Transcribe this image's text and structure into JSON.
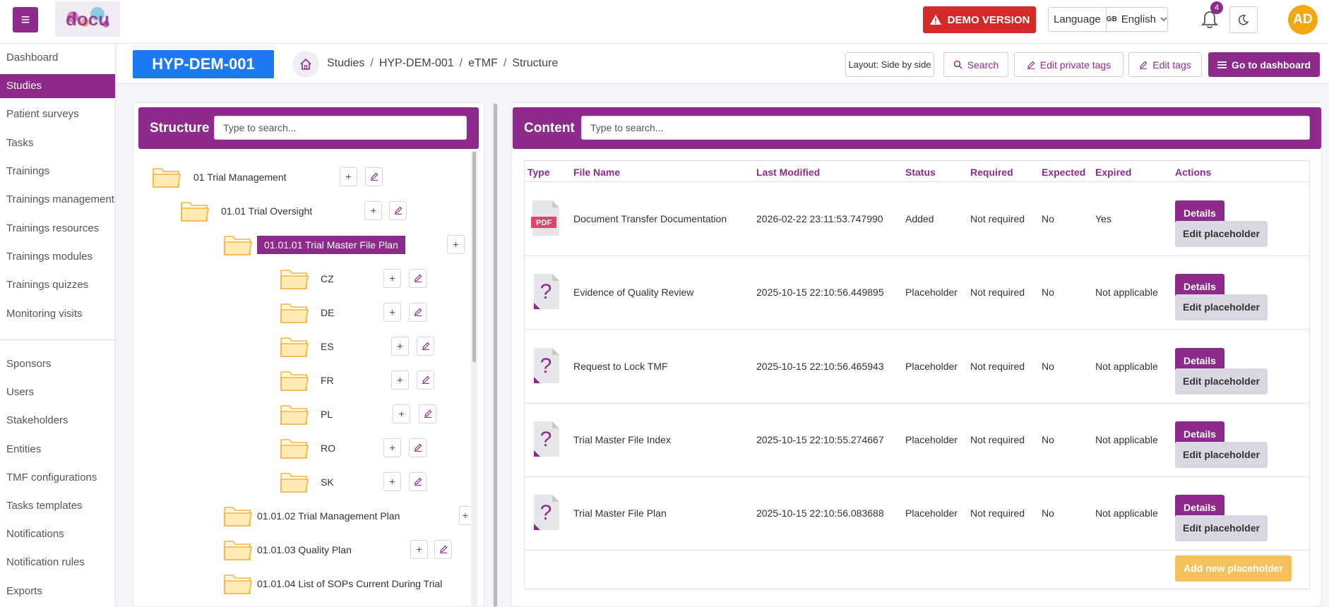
{
  "topbar": {
    "menu_icon": "hamburger-icon",
    "demo_label": "DEMO VERSION",
    "language_label": "Language",
    "language_flag": "GB",
    "language_value": "English",
    "notification_count": "4",
    "avatar_initials": "AD"
  },
  "sidebar": {
    "items": [
      "Dashboard",
      "Studies",
      "Patient surveys",
      "Tasks",
      "Trainings",
      "Trainings management",
      "Trainings resources",
      "Trainings modules",
      "Trainings quizzes",
      "Monitoring visits",
      "Sponsors",
      "Users",
      "Stakeholders",
      "Entities",
      "TMF configurations",
      "Tasks templates",
      "Notifications",
      "Notification rules",
      "Exports"
    ],
    "active": "Studies"
  },
  "header": {
    "study_id": "HYP-DEM-001",
    "breadcrumb": [
      "Studies",
      "HYP-DEM-001",
      "eTMF",
      "Structure"
    ],
    "layout_label": "Layout: Side by side",
    "search_label": "Search",
    "edit_private_tags_label": "Edit private tags",
    "edit_tags_label": "Edit tags",
    "go_to_dashboard_label": "Go to dashboard"
  },
  "structure": {
    "title": "Structure",
    "search_placeholder": "Type to search...",
    "tree": [
      {
        "label": "01 Trial Management",
        "level": 0
      },
      {
        "label": "01.01 Trial Oversight",
        "level": 1
      },
      {
        "label": "01.01.01 Trial Master File Plan",
        "level": 2,
        "selected": true
      },
      {
        "label": "CZ",
        "level": 3
      },
      {
        "label": "DE",
        "level": 3
      },
      {
        "label": "ES",
        "level": 3
      },
      {
        "label": "FR",
        "level": 3
      },
      {
        "label": "PL",
        "level": 3
      },
      {
        "label": "RO",
        "level": 3
      },
      {
        "label": "SK",
        "level": 3
      },
      {
        "label": "01.01.02 Trial Management Plan",
        "level": 2
      },
      {
        "label": "01.01.03 Quality Plan",
        "level": 2
      },
      {
        "label": "01.01.04 List of SOPs Current During Trial",
        "level": 2
      }
    ]
  },
  "content": {
    "title": "Content",
    "search_placeholder": "Type to search...",
    "columns": [
      "Type",
      "File Name",
      "Last Modified",
      "Status",
      "Required",
      "Expected",
      "Expired",
      "Actions"
    ],
    "rows": [
      {
        "type": "pdf",
        "name": "Document Transfer Documentation",
        "modified": "2026-02-22 23:11:53.747990",
        "status": "Added",
        "required": "Not required",
        "expected": "No",
        "expired": "Yes"
      },
      {
        "type": "placeholder",
        "name": "Evidence of Quality Review",
        "modified": "2025-10-15 22:10:56.449895",
        "status": "Placeholder",
        "required": "Not required",
        "expected": "No",
        "expired": "Not applicable"
      },
      {
        "type": "placeholder",
        "name": "Request to Lock TMF",
        "modified": "2025-10-15 22:10:56.465943",
        "status": "Placeholder",
        "required": "Not required",
        "expected": "No",
        "expired": "Not applicable"
      },
      {
        "type": "placeholder",
        "name": "Trial Master File Index",
        "modified": "2025-10-15 22:10:55.274667",
        "status": "Placeholder",
        "required": "Not required",
        "expected": "No",
        "expired": "Not applicable"
      },
      {
        "type": "placeholder",
        "name": "Trial Master File Plan",
        "modified": "2025-10-15 22:10:56.083688",
        "status": "Placeholder",
        "required": "Not required",
        "expected": "No",
        "expired": "Not applicable"
      }
    ],
    "details_label": "Details",
    "edit_placeholder_label": "Edit placeholder",
    "add_placeholder_label": "Add new placeholder",
    "pdf_label": "PDF"
  },
  "colors": {
    "primary": "#8e2a8c",
    "demo": "#d6292a",
    "study_id": "#1d79f2",
    "add_button": "#f5c15c",
    "avatar": "#f3a712"
  }
}
